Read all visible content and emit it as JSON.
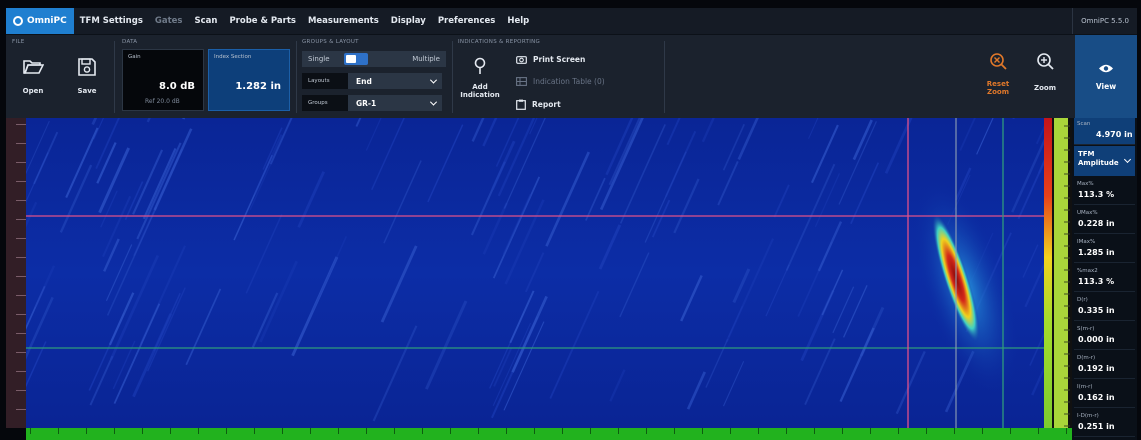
{
  "menu": {
    "brand": "OmniPC",
    "items": [
      "TFM Settings",
      "Gates",
      "Scan",
      "Probe & Parts",
      "Measurements",
      "Display",
      "Preferences",
      "Help"
    ],
    "version": "OmniPC 5.5.0"
  },
  "ribbon": {
    "file": {
      "title": "FILE",
      "open_label": "Open",
      "save_label": "Save"
    },
    "data": {
      "title": "DATA",
      "gain_label": "Gain",
      "gain_value": "8.0 dB",
      "gain_ref": "Ref 20.0 dB",
      "index_label": "Index Section",
      "index_value": "1.282 in"
    },
    "groups_layout": {
      "title": "GROUPS & LAYOUT",
      "single_label": "Single",
      "multiple_label": "Multiple",
      "layouts_label": "Layouts",
      "layouts_value": "End",
      "groups_label": "Groups",
      "groups_value": "GR-1"
    },
    "indications": {
      "title": "INDICATIONS & REPORTING",
      "add_label": "Add Indication",
      "print_label": "Print Screen",
      "table_label": "Indication Table (0)",
      "report_label": "Report"
    },
    "reset_zoom_label": "Reset Zoom",
    "zoom_label": "Zoom",
    "view_label": "View"
  },
  "readings": {
    "scan_label": "Scan",
    "scan_value": "4.970 in",
    "mode_value": "TFM Amplitude",
    "items": [
      {
        "label": "Max%",
        "value": "113.3 %"
      },
      {
        "label": "UMax%",
        "value": "0.228 in"
      },
      {
        "label": "IMax%",
        "value": "1.285 in"
      },
      {
        "label": "%max2",
        "value": "113.3 %"
      },
      {
        "label": "D(r)",
        "value": "0.335 in"
      },
      {
        "label": "S(m-r)",
        "value": "0.000 in"
      },
      {
        "label": "D(m-r)",
        "value": "0.192 in"
      },
      {
        "label": "I(m-r)",
        "value": "0.162 in"
      },
      {
        "label": "I-D(m-r)",
        "value": "0.251 in"
      }
    ]
  },
  "colors": {
    "accent": "#1f7fd0",
    "scan_bg": "#0b2aa0",
    "cursor_red": "#e0508a",
    "cursor_green": "#2f9a7c",
    "zoom_orange": "#e0782a"
  }
}
